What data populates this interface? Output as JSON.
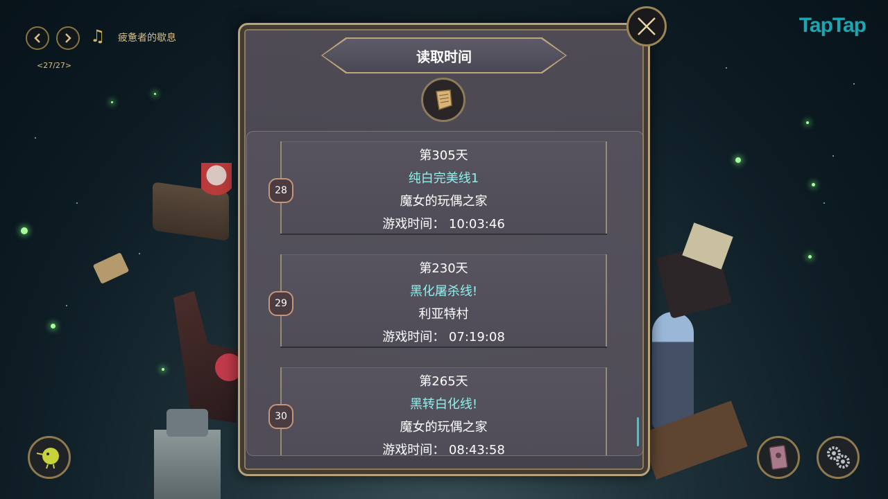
{
  "music": {
    "prev_icon": "chevron-left-icon",
    "next_icon": "chevron-right-icon",
    "note_icon": "♫",
    "track_title": "疲惫者的歇息",
    "track_count": "<27/27>"
  },
  "brand": {
    "logo": "TapTap"
  },
  "dialog": {
    "title": "读取时间",
    "close_icon": "close-icon",
    "emblem_icon": "scroll-icon"
  },
  "slots": [
    {
      "number": "28",
      "day": "第305天",
      "route": "纯白完美线1",
      "location": "魔女的玩偶之家",
      "play_time": "游戏时间： 10:03:46"
    },
    {
      "number": "29",
      "day": "第230天",
      "route": "黑化屠杀线!",
      "location": "利亚特村",
      "play_time": "游戏时间： 07:19:08"
    },
    {
      "number": "30",
      "day": "第265天",
      "route": "黑转白化线!",
      "location": "魔女的玩偶之家",
      "play_time": "游戏时间： 08:43:58"
    }
  ],
  "bottom": {
    "left_icon": "character-bird-icon",
    "book_icon": "book-icon",
    "settings_icon": "gears-icon"
  },
  "colors": {
    "route_text": "#8ff0ec",
    "gold_border": "#b8a27a",
    "brand": "#1aa7b3"
  }
}
